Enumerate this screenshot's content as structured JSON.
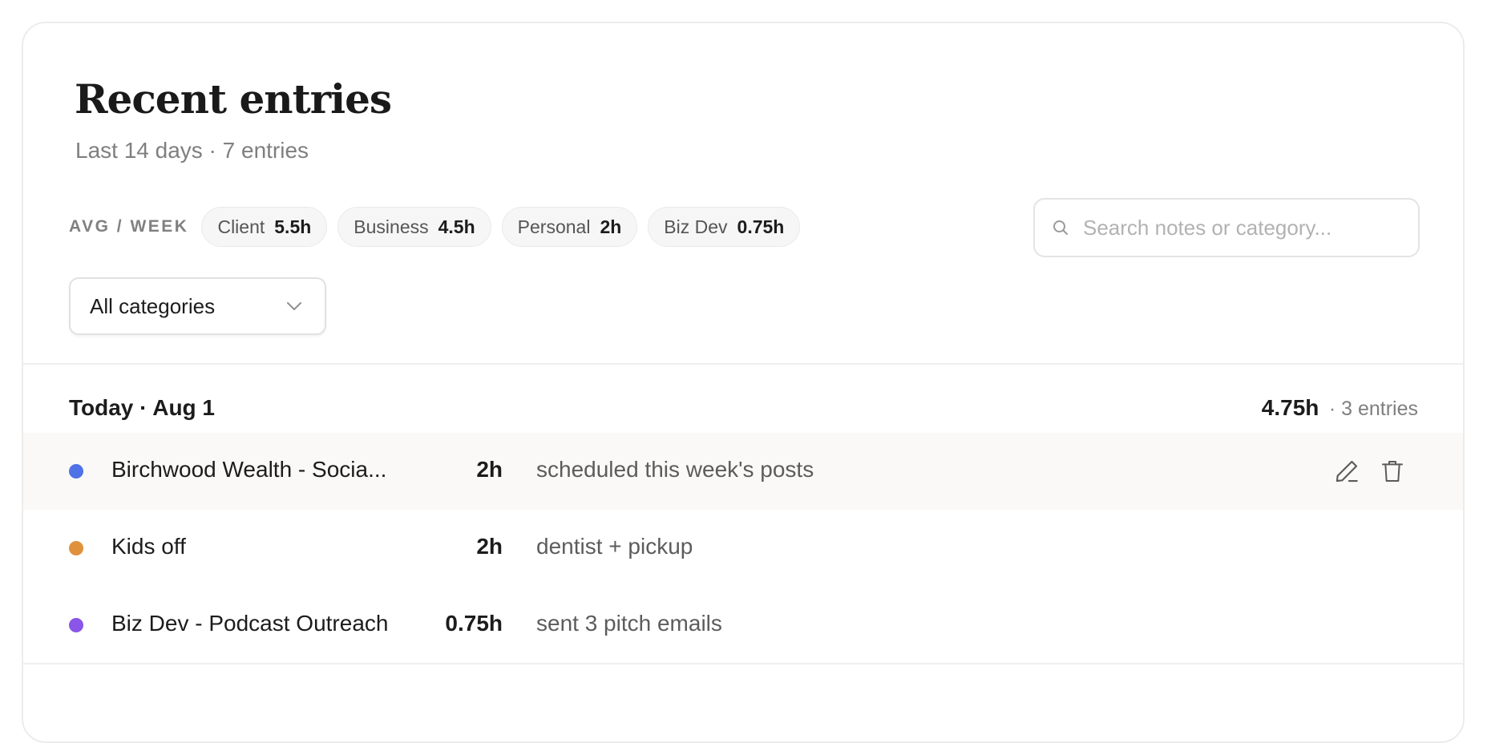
{
  "header": {
    "title": "Recent entries",
    "subtitle": "Last 14 days · 7 entries"
  },
  "averages": {
    "label": "AVG / WEEK",
    "items": [
      {
        "name": "Client",
        "value": "5.5h"
      },
      {
        "name": "Business",
        "value": "4.5h"
      },
      {
        "name": "Personal",
        "value": "2h"
      },
      {
        "name": "Biz Dev",
        "value": "0.75h"
      }
    ]
  },
  "search": {
    "placeholder": "Search notes or category...",
    "value": "",
    "icon": "search-icon"
  },
  "filter": {
    "selected": "All categories",
    "icon": "chevron-down-icon"
  },
  "groups": [
    {
      "title": "Today · Aug 1",
      "total": "4.75h",
      "count": "· 3 entries",
      "entries": [
        {
          "name": "Birchwood Wealth - Socia...",
          "hours": "2h",
          "note": "scheduled this week's posts",
          "color": "#4f72e6",
          "hovered": true,
          "actions": [
            "pencil-icon",
            "trash-icon"
          ]
        },
        {
          "name": "Kids off",
          "hours": "2h",
          "note": "dentist + pickup",
          "color": "#e0913c",
          "hovered": false
        },
        {
          "name": "Biz Dev - Podcast Outreach",
          "hours": "0.75h",
          "note": "sent 3 pitch emails",
          "color": "#8a55e8",
          "hovered": false
        }
      ]
    }
  ]
}
